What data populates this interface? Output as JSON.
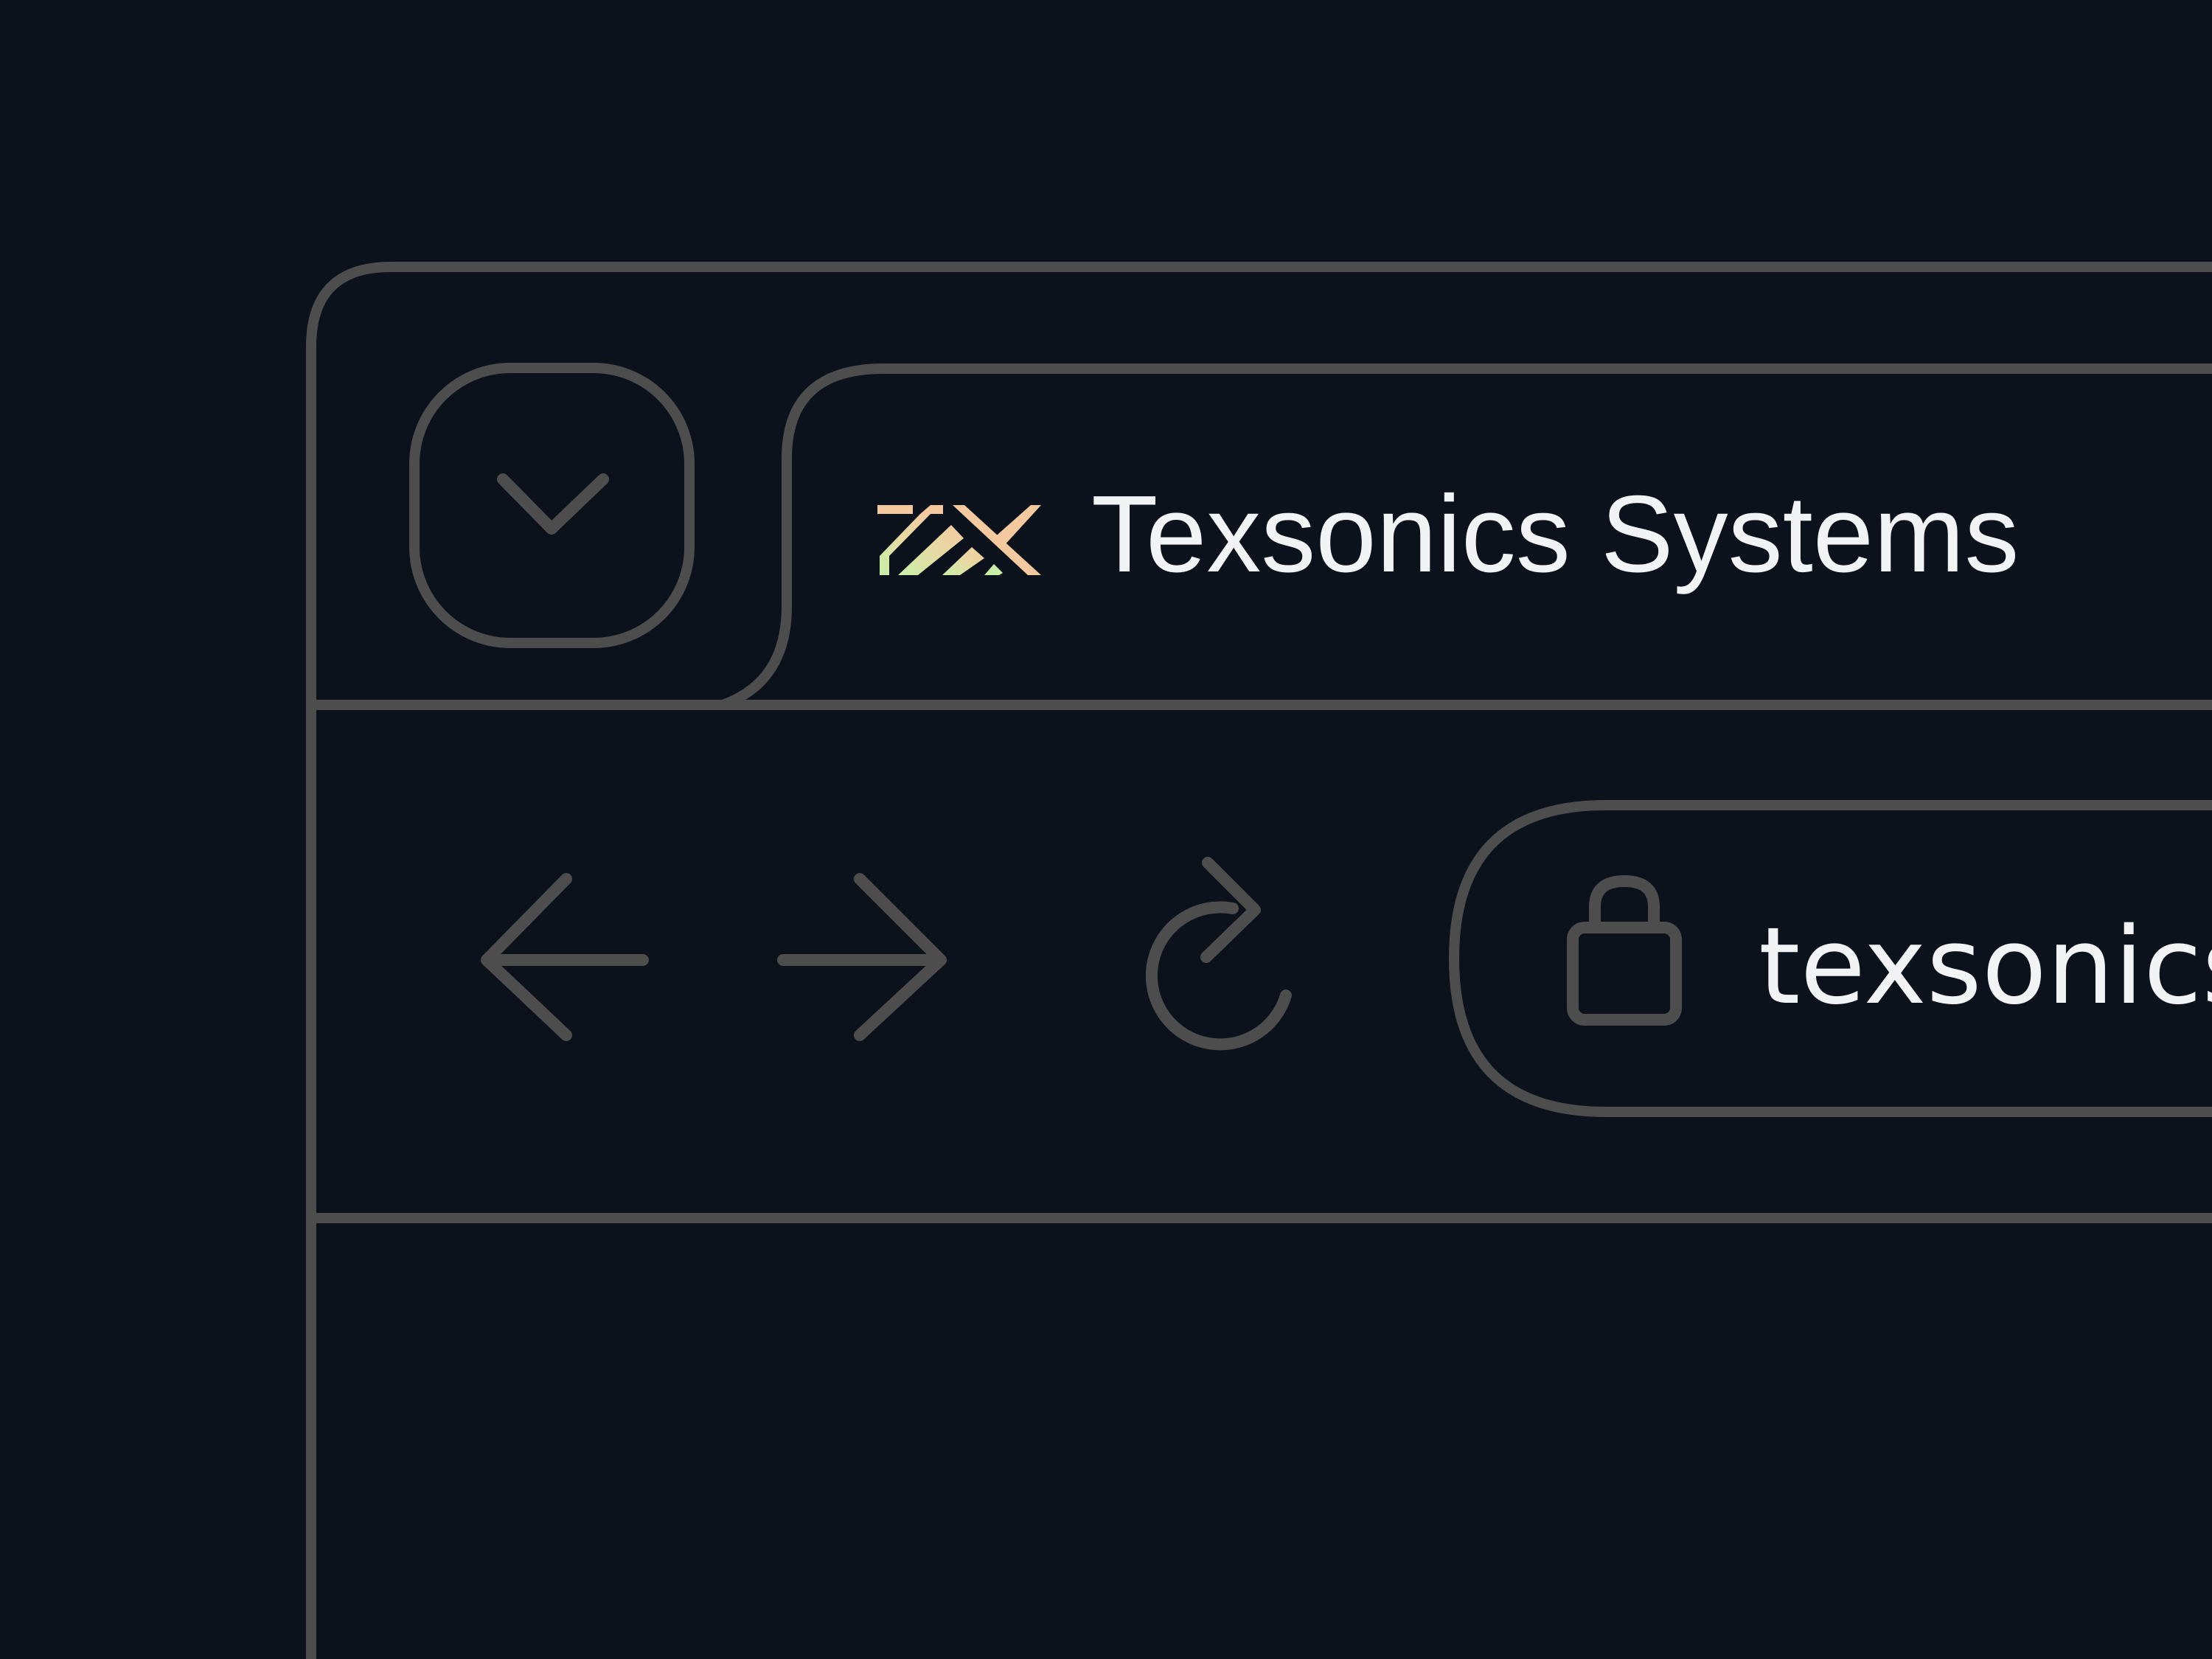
{
  "tab": {
    "title": "Texsonics Systems",
    "favicon_icon": "texsonics-logo-icon"
  },
  "tab_menu": {
    "icon": "chevron-down-icon"
  },
  "toolbar": {
    "back_icon": "arrow-left-icon",
    "forward_icon": "arrow-right-icon",
    "reload_icon": "reload-icon"
  },
  "address_bar": {
    "lock_icon": "lock-icon",
    "url": "texsonics"
  },
  "colors": {
    "background": "#0b121b",
    "outline": "#4d4d4d",
    "text": "#f2f3f5",
    "logo_orange": "#f5c9a0",
    "logo_green": "#c8f0a8"
  }
}
